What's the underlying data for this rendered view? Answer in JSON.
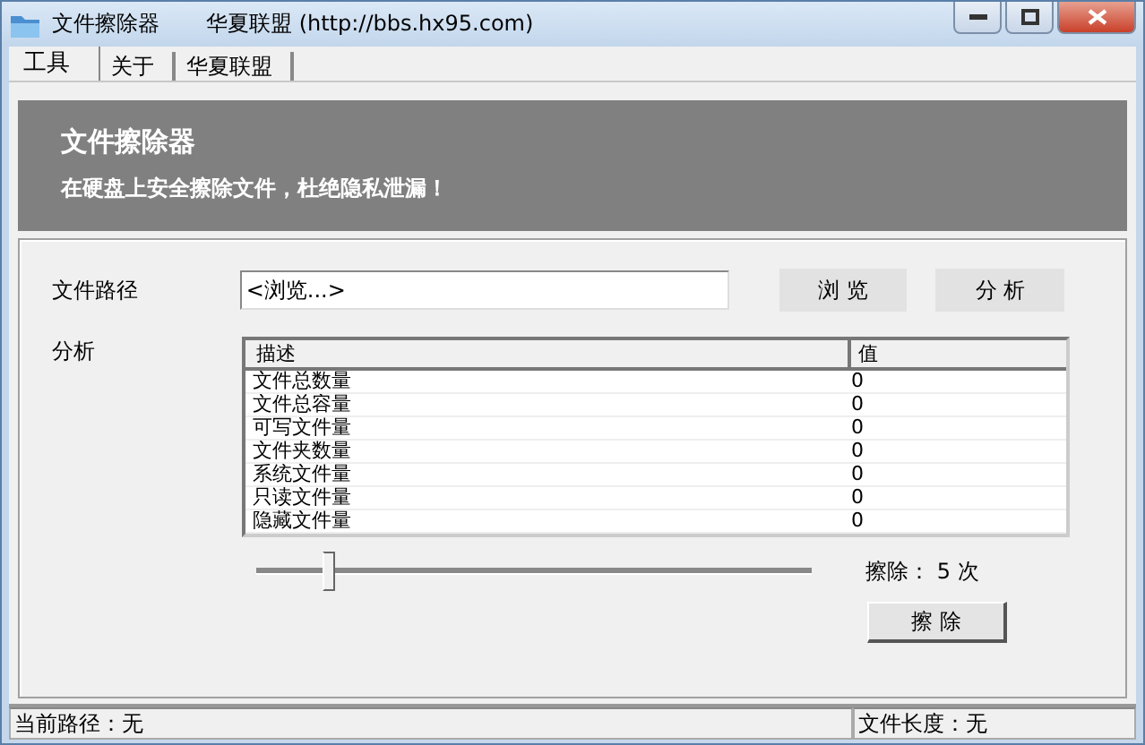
{
  "window": {
    "title": "文件擦除器",
    "subtitle": "华夏联盟 (http://bbs.hx95.com)"
  },
  "tabs": [
    {
      "label": "工具",
      "selected": true
    },
    {
      "label": "关于",
      "selected": false
    },
    {
      "label": "华夏联盟",
      "selected": false
    }
  ],
  "header": {
    "title": "文件擦除器",
    "subtitle": "在硬盘上安全擦除文件，杜绝隐私泄漏！"
  },
  "path": {
    "label": "文件路径",
    "value": "<浏览...>"
  },
  "buttons": {
    "browse": "浏 览",
    "analyze": "分 析",
    "erase": "擦 除"
  },
  "analysis": {
    "label": "分析",
    "columns": [
      "描述",
      "值"
    ],
    "rows": [
      [
        "文件总数量",
        "0"
      ],
      [
        "文件总容量",
        "0"
      ],
      [
        "可写文件量",
        "0"
      ],
      [
        "文件夹数量",
        "0"
      ],
      [
        "系统文件量",
        "0"
      ],
      [
        "只读文件量",
        "0"
      ],
      [
        "隐藏文件量",
        "0"
      ]
    ]
  },
  "passes": {
    "level": 0.13,
    "reading": "擦除： 5 次"
  },
  "status_bar": [
    "当前路径：无",
    "文件长度：无"
  ]
}
